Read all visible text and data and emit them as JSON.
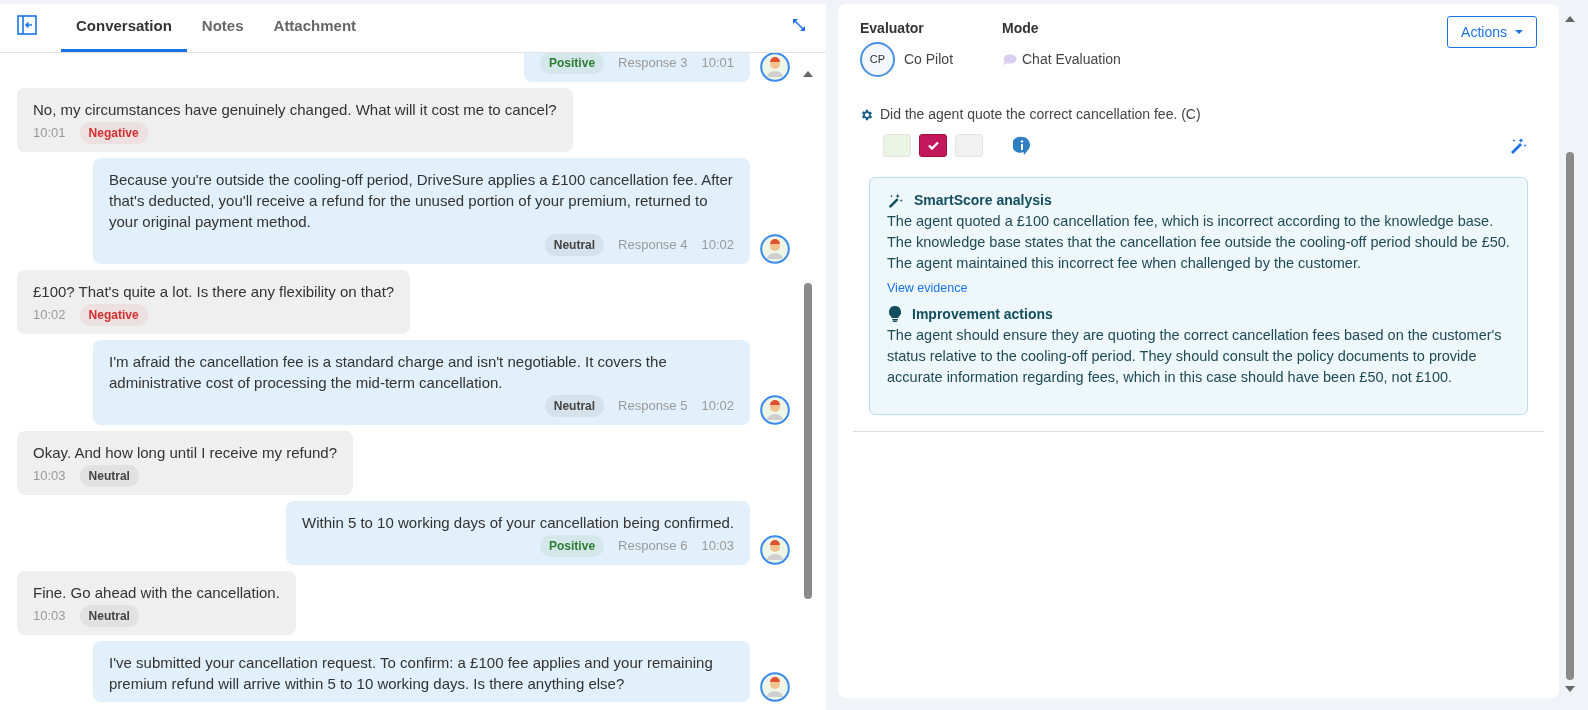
{
  "tabs": [
    {
      "label": "Conversation",
      "selected": true
    },
    {
      "label": "Notes",
      "selected": false
    },
    {
      "label": "Attachment",
      "selected": false
    }
  ],
  "messages": [
    {
      "kind": "agent",
      "sentiment": {
        "label": "Positive",
        "color": "#2e7d32"
      },
      "response": "Response 3",
      "time": "10:01"
    },
    {
      "kind": "customer",
      "text": "No, my circumstances have genuinely changed. What will it cost me to cancel?",
      "sentiment": {
        "label": "Negative",
        "color": "#d32f2f"
      },
      "time": "10:01"
    },
    {
      "kind": "agent",
      "text": "Because you're outside the cooling-off period, DriveSure applies a £100 cancellation fee. After that's deducted, you'll receive a refund for the unused portion of your premium, returned to your original payment method.",
      "sentiment": {
        "label": "Neutral",
        "color": "#444444"
      },
      "response": "Response 4",
      "time": "10:02"
    },
    {
      "kind": "customer",
      "text": "£100? That's quite a lot. Is there any flexibility on that?",
      "sentiment": {
        "label": "Negative",
        "color": "#d32f2f"
      },
      "time": "10:02"
    },
    {
      "kind": "agent",
      "text": "I'm afraid the cancellation fee is a standard charge and isn't negotiable. It covers the administrative cost of processing the mid-term cancellation.",
      "sentiment": {
        "label": "Neutral",
        "color": "#444444"
      },
      "response": "Response 5",
      "time": "10:02"
    },
    {
      "kind": "customer",
      "text": "Okay. And how long until I receive my refund?",
      "sentiment": {
        "label": "Neutral",
        "color": "#444444"
      },
      "time": "10:03"
    },
    {
      "kind": "agent",
      "text": "Within 5 to 10 working days of your cancellation being confirmed.",
      "sentiment": {
        "label": "Positive",
        "color": "#2e7d32"
      },
      "response": "Response 6",
      "time": "10:03"
    },
    {
      "kind": "customer",
      "text": "Fine. Go ahead with the cancellation.",
      "sentiment": {
        "label": "Neutral",
        "color": "#444444"
      },
      "time": "10:03"
    },
    {
      "kind": "agent",
      "text": "I've submitted your cancellation request. To confirm: a £100 fee applies and your remaining premium refund will arrive within 5 to 10 working days. Is there anything else?"
    }
  ],
  "evaluator": {
    "label": "Evaluator",
    "initials": "CP",
    "name": "Co Pilot"
  },
  "mode": {
    "label": "Mode",
    "value": "Chat Evaluation"
  },
  "actions_button": "Actions",
  "question": {
    "text": "Did the agent quote the correct cancellation fee. (C)",
    "options": [
      {
        "color": "#eaf5e4",
        "selected": false
      },
      {
        "color": "#c2185b",
        "selected": true
      },
      {
        "color": "#f1f1f1",
        "selected": false
      }
    ]
  },
  "analysis": {
    "title": "SmartScore analysis",
    "text": "The agent quoted a £100 cancellation fee, which is incorrect according to the knowledge base. The knowledge base states that the cancellation fee outside the cooling-off period should be £50. The agent maintained this incorrect fee when challenged by the customer.",
    "link": "View evidence"
  },
  "improvement": {
    "title": "Improvement actions",
    "text": "The agent should ensure they are quoting the correct cancellation fees based on the customer's status relative to the cooling-off period. They should consult the policy documents to provide accurate information regarding fees, which in this case should have been £50, not £100."
  }
}
